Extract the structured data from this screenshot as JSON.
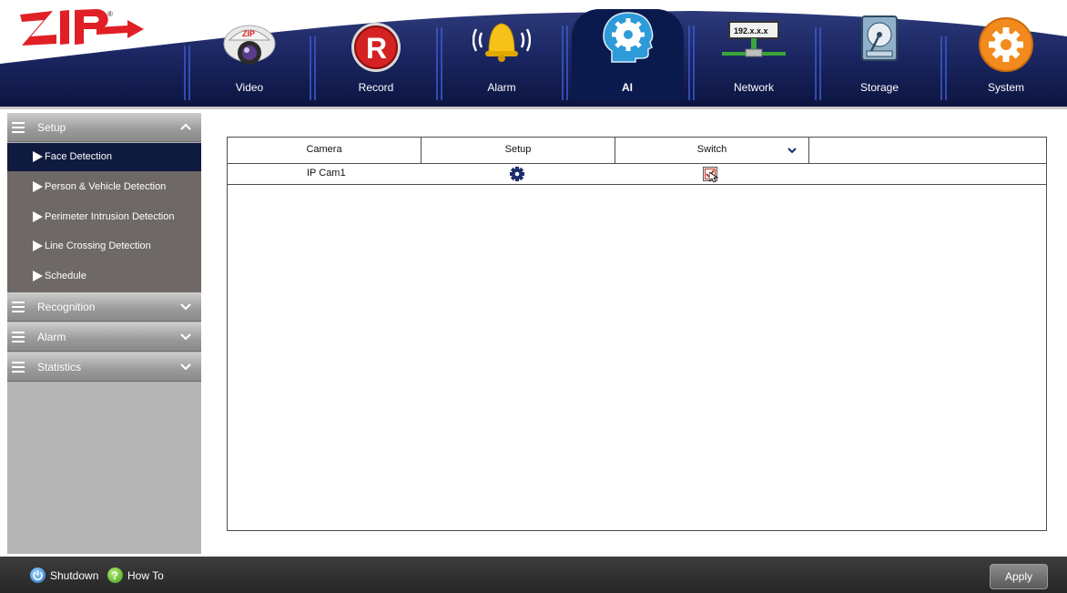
{
  "brand": {
    "logo_text": "ZIP",
    "registered_mark": "®"
  },
  "nav": {
    "tabs": [
      {
        "label": "Video",
        "icon": "camera-icon"
      },
      {
        "label": "Record",
        "icon": "record-icon"
      },
      {
        "label": "Alarm",
        "icon": "alarm-bell-icon"
      },
      {
        "label": "AI",
        "icon": "ai-head-gear-icon",
        "active": true
      },
      {
        "label": "Network",
        "icon": "network-icon",
        "icon_text": "192.x.x.x"
      },
      {
        "label": "Storage",
        "icon": "hard-drive-icon"
      },
      {
        "label": "System",
        "icon": "system-gear-icon"
      }
    ]
  },
  "sidebar": {
    "sections": [
      {
        "label": "Setup",
        "expanded": true
      },
      {
        "label": "Recognition",
        "expanded": false
      },
      {
        "label": "Alarm",
        "expanded": false
      },
      {
        "label": "Statistics",
        "expanded": false
      }
    ],
    "setup_items": [
      {
        "label": "Face Detection",
        "selected": true
      },
      {
        "label": "Person & Vehicle Detection"
      },
      {
        "label": "Perimeter Intrusion Detection"
      },
      {
        "label": "Line Crossing Detection"
      },
      {
        "label": "Schedule"
      }
    ]
  },
  "table": {
    "headers": {
      "camera": "Camera",
      "setup": "Setup",
      "switch": "Switch"
    },
    "rows": [
      {
        "camera": "IP Cam1",
        "setup_icon": "gear-icon",
        "switch_checked": true
      }
    ]
  },
  "footer": {
    "shutdown_label": "Shutdown",
    "howto_label": "How To",
    "apply_label": "Apply"
  },
  "colors": {
    "header_navy": "#0b1a4d",
    "selected_item": "#0f1a3f",
    "sidebar_body": "#6e6866",
    "checkbox_red": "#c0392b"
  }
}
